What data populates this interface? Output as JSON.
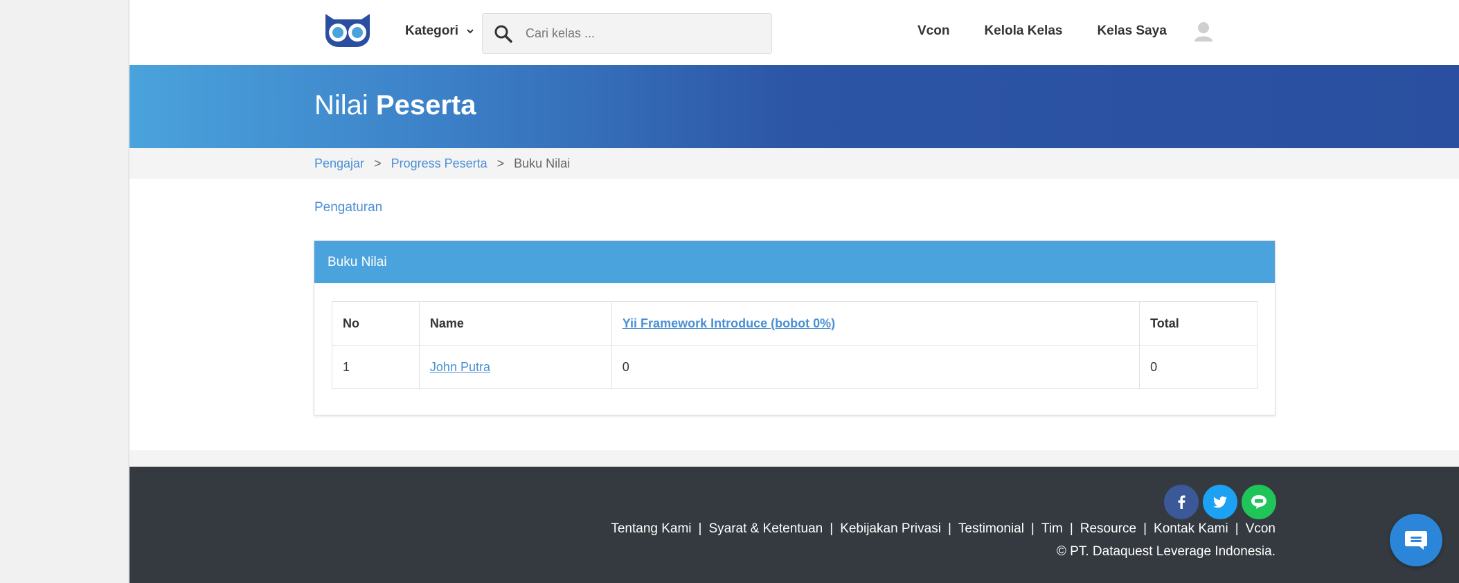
{
  "navbar": {
    "kategori_label": "Kategori",
    "search_placeholder": "Cari kelas ...",
    "links": [
      "Vcon",
      "Kelola Kelas",
      "Kelas Saya"
    ]
  },
  "banner": {
    "title_light": "Nilai",
    "title_bold": "Peserta"
  },
  "breadcrumb": {
    "items": [
      "Pengajar",
      "Progress Peserta",
      "Buku Nilai"
    ],
    "separator": ">"
  },
  "settings_link": "Pengaturan",
  "panel": {
    "title": "Buku Nilai",
    "columns": [
      "No",
      "Name",
      "Yii Framework Introduce (bobot 0%)",
      "Total"
    ],
    "rows": [
      {
        "no": "1",
        "name": "John Putra",
        "grade": "0",
        "total": "0"
      }
    ]
  },
  "footer": {
    "links": [
      "Tentang Kami",
      "Syarat & Ketentuan",
      "Kebijakan Privasi",
      "Testimonial",
      "Tim",
      "Resource",
      "Kontak Kami",
      "Vcon"
    ],
    "separator": "|",
    "copyright": "© PT. Dataquest Leverage Indonesia."
  },
  "colors": {
    "brand_blue": "#4aa3dc",
    "banner_dark": "#2a4fa0",
    "footer_bg": "#343a40",
    "link": "#4a8fd4"
  },
  "icons": [
    "owl-logo",
    "chevron-down-icon",
    "search-icon",
    "avatar-icon",
    "facebook-icon",
    "twitter-icon",
    "line-icon",
    "chat-icon"
  ]
}
